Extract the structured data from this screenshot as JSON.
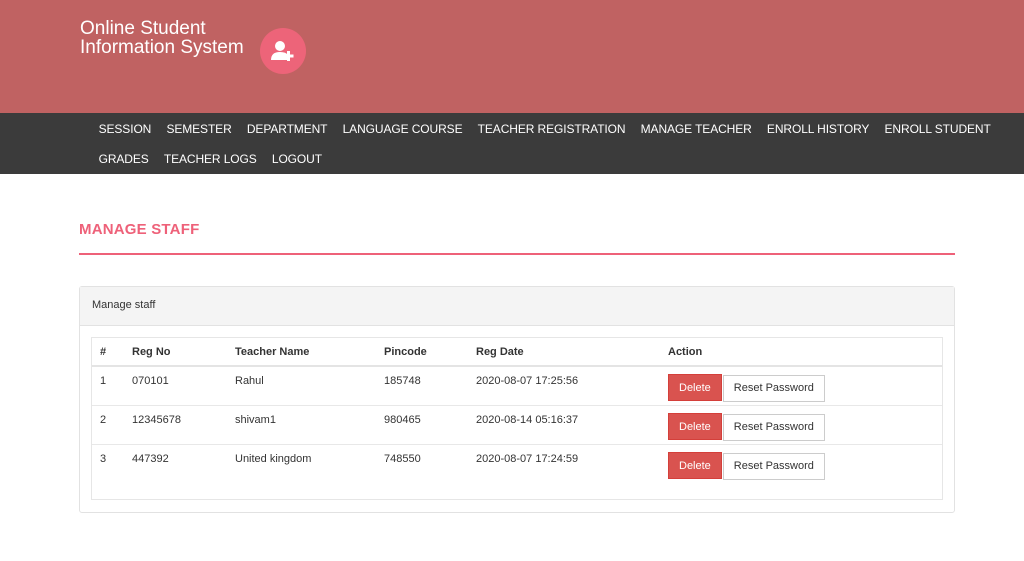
{
  "header": {
    "title_line1": "Online Student",
    "title_line2": "Information System",
    "logo_icon": "user-plus-icon"
  },
  "nav": {
    "row1": [
      "SESSION",
      "SEMESTER",
      "DEPARTMENT",
      "LANGUAGE COURSE",
      "TEACHER REGISTRATION",
      "MANAGE TEACHER",
      "ENROLL HISTORY",
      "ENROLL STUDENT"
    ],
    "row2": [
      "GRADES",
      "TEACHER LOGS",
      "LOGOUT"
    ]
  },
  "page": {
    "title": "MANAGE STAFF",
    "panel_heading": "Manage staff"
  },
  "table": {
    "headers": [
      "#",
      "Reg No",
      "Teacher Name",
      "Pincode",
      "Reg Date",
      "Action"
    ],
    "rows": [
      {
        "num": "1",
        "reg_no": "070101",
        "name": "Rahul",
        "pincode": "185748",
        "reg_date": "2020-08-07 17:25:56",
        "delete_label": "Delete",
        "reset_label": "Reset Password"
      },
      {
        "num": "2",
        "reg_no": "12345678",
        "name": "shivam1",
        "pincode": "980465",
        "reg_date": "2020-08-14 05:16:37",
        "delete_label": "Delete",
        "reset_label": "Reset Password"
      },
      {
        "num": "3",
        "reg_no": "447392",
        "name": "United kingdom",
        "pincode": "748550",
        "reg_date": "2020-08-07 17:24:59",
        "delete_label": "Delete",
        "reset_label": "Reset Password"
      }
    ]
  },
  "colors": {
    "header_bg": "#c06262",
    "navbar_bg": "#3b3b3b",
    "accent": "#ee6179",
    "delete_button": "#d9534f"
  }
}
